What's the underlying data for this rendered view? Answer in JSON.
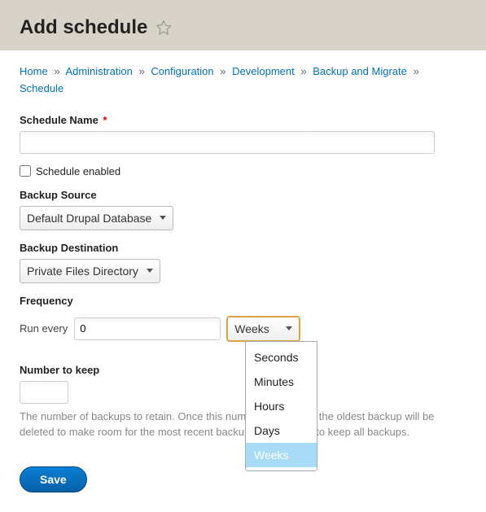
{
  "header": {
    "title": "Add schedule"
  },
  "breadcrumb": {
    "items": [
      "Home",
      "Administration",
      "Configuration",
      "Development",
      "Backup and Migrate",
      "Schedule"
    ],
    "separator": "»"
  },
  "form": {
    "schedule_name": {
      "label": "Schedule Name",
      "value": "",
      "required": true
    },
    "schedule_enabled": {
      "label": "Schedule enabled",
      "checked": false
    },
    "backup_source": {
      "label": "Backup Source",
      "selected": "Default Drupal Database"
    },
    "backup_destination": {
      "label": "Backup Destination",
      "selected": "Private Files Directory"
    },
    "frequency": {
      "label": "Frequency",
      "prefix": "Run every",
      "value": "0",
      "unit_selected": "Weeks",
      "unit_options": [
        "Seconds",
        "Minutes",
        "Hours",
        "Days",
        "Weeks"
      ],
      "dropdown_open": true,
      "highlighted": "Weeks"
    },
    "number_to_keep": {
      "label": "Number to keep",
      "value": "",
      "help": "The number of backups to retain. Once this number is reached, the oldest backup will be deleted to make room for the most recent backup. Leave blank to keep all backups."
    },
    "save_label": "Save"
  }
}
